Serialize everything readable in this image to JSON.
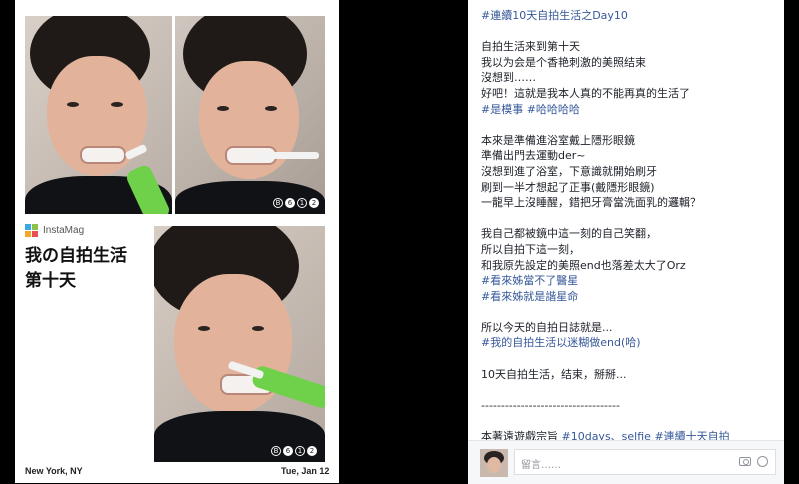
{
  "collage": {
    "brand": "InstaMag",
    "title_line1": "我の自拍生活",
    "title_line2": "第十天",
    "location": "New York, NY",
    "date": "Tue, Jan 12",
    "badge1": [
      "B",
      "6",
      "1",
      "2"
    ],
    "badge2": [
      "B",
      "6",
      "1",
      "2"
    ],
    "badge3": [
      "B",
      "6",
      "1",
      "2"
    ]
  },
  "post": {
    "lines": [
      {
        "text": "#連續10天自拍生活之Day10",
        "tag": true
      },
      {
        "text": "",
        "gap": true
      },
      {
        "text": "自拍生活来到第十天"
      },
      {
        "text": "我以为会是个香艳刺激的美照结束"
      },
      {
        "text": "沒想到……"
      },
      {
        "text": "好吧！這就是我本人真的不能再真的生活了"
      },
      {
        "text": "#是模事 #哈哈哈哈",
        "tag": true
      },
      {
        "text": "",
        "gap": true
      },
      {
        "text": "本來是準備進浴室戴上隱形眼鏡"
      },
      {
        "text": "準備出門去運動der~"
      },
      {
        "text": "沒想到進了浴室，下意識就開始刷牙"
      },
      {
        "text": "刷到一半才想起了正事(戴隱形眼鏡)"
      },
      {
        "text": "一龍早上沒睡醒，錯把牙膏當洗面乳的邏輯？"
      },
      {
        "text": "",
        "gap": true
      },
      {
        "text": "我自己都被鏡中這一刻的自己笑翻，"
      },
      {
        "text": "所以自拍下這一刻，"
      },
      {
        "text": "和我原先設定的美照end也落差太大了Orz"
      },
      {
        "text": "#看來姊當不了醫星",
        "tag": true
      },
      {
        "text": "#看來姊就是諧星命",
        "tag": true
      },
      {
        "text": "",
        "gap": true
      },
      {
        "text": "所以今天的自拍日誌就是..."
      },
      {
        "text": "#我的自拍生活以迷糊做end(哈)",
        "tag": true
      },
      {
        "text": "",
        "gap": true
      },
      {
        "text": "10天自拍生活，结束，掰掰..."
      },
      {
        "text": "",
        "gap": true
      },
      {
        "text": "-----------------------------------"
      },
      {
        "text": "",
        "gap": true
      },
      {
        "text": "本著遠遊戲宗旨 #10days、selfie #連續十天自拍",
        "tag": false
      }
    ]
  },
  "comment": {
    "placeholder": "留言……"
  },
  "icons": {
    "camera": "camera-icon",
    "emoji": "smiley-icon"
  },
  "colors": {
    "hashtag": "#365899",
    "text": "#1d2129",
    "brush": "#6fd04a"
  }
}
